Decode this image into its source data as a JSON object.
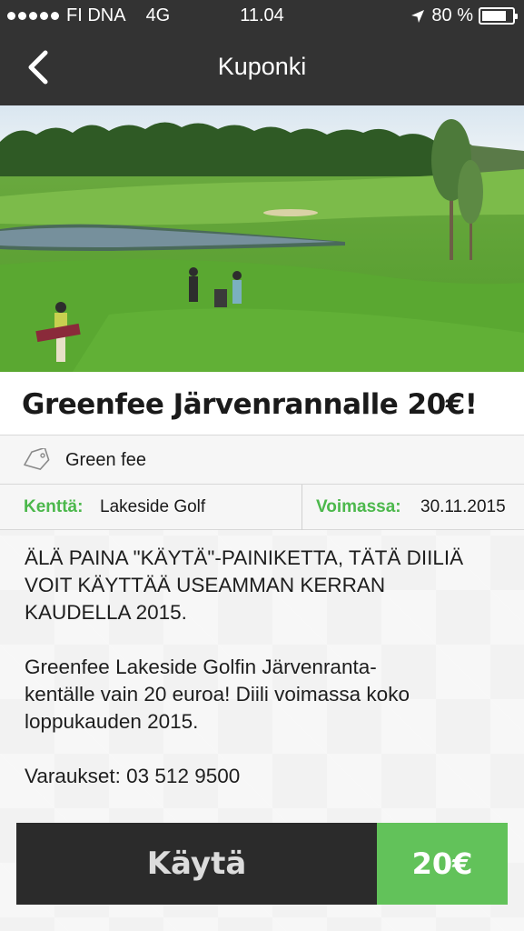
{
  "status_bar": {
    "carrier": "FI DNA",
    "network": "4G",
    "time": "11.04",
    "battery": "80 %",
    "battery_level": 0.8
  },
  "nav": {
    "title": "Kuponki",
    "back_icon": "chevron-left-icon"
  },
  "hero": {
    "image": "golf-course-photo"
  },
  "coupon": {
    "title": "Greenfee Järvenrannalle 20€!",
    "category_icon": "tag-icon",
    "category": "Green fee",
    "field_label": "Kenttä:",
    "field_value": "Lakeside Golf",
    "valid_label": "Voimassa:",
    "valid_value": "30.11.2015",
    "description": [
      "ÄLÄ PAINA \"KÄYTÄ\"-PAINIKETTA, TÄTÄ DIILIÄ\nVOIT KÄYTTÄÄ USEAMMAN KERRAN\nKAUDELLA 2015.",
      "Greenfee Lakeside Golfin Järvenranta-\nkentälle vain 20 euroa! Diili voimassa koko\nloppukauden 2015.",
      "Varaukset: 03 512 9500"
    ]
  },
  "actions": {
    "use_label": "Käytä",
    "price": "20€"
  },
  "colors": {
    "header": "#333333",
    "accent_green": "#4cb84c",
    "price_green": "#62c25a",
    "button_dark": "#2b2b2b"
  }
}
